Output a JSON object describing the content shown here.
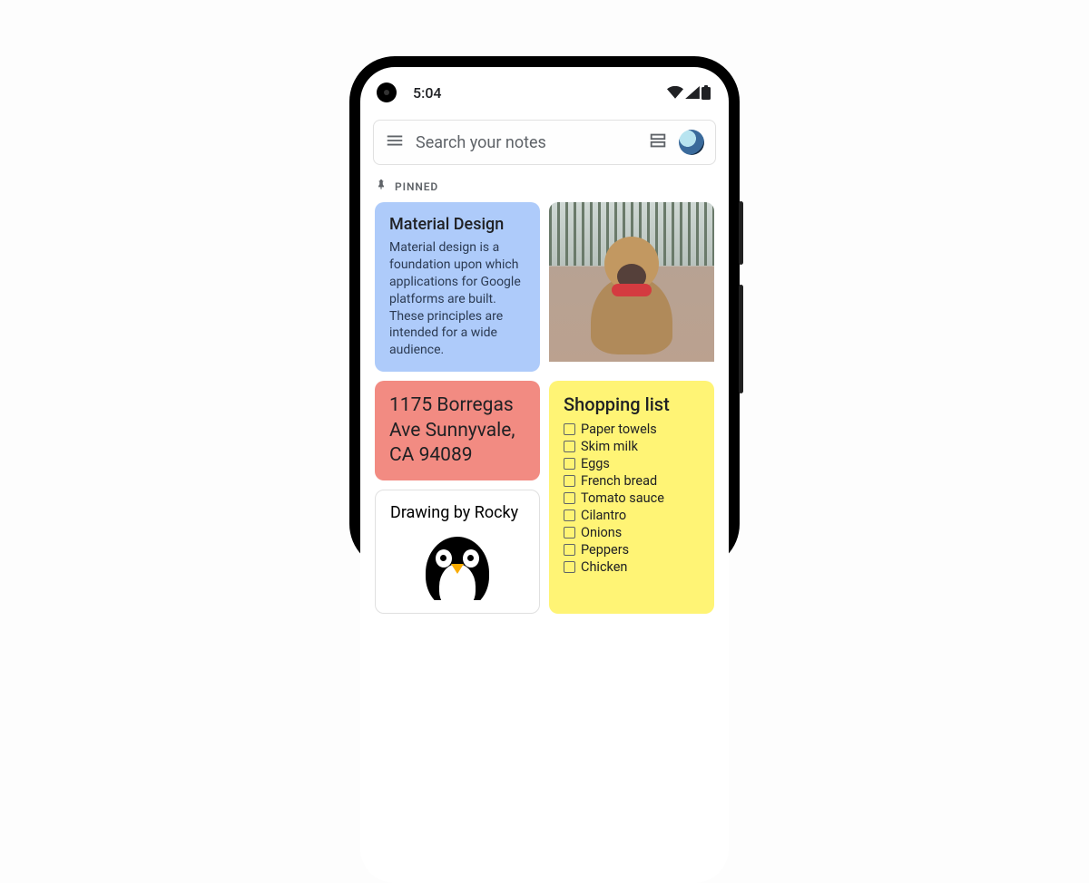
{
  "statusbar": {
    "time": "5:04"
  },
  "search": {
    "placeholder": "Search your notes"
  },
  "section_pinned_label": "PINNED",
  "notes": {
    "material": {
      "title": "Material Design",
      "body": "Material design is a foundation upon which applications for Google platforms are built. These principles are intended for a wide audience."
    },
    "address": {
      "text": "1175 Borregas Ave Sunnyvale, CA 94089"
    },
    "drawing": {
      "title": "Drawing by Rocky"
    },
    "shopping": {
      "title": "Shopping list",
      "items": [
        "Paper towels",
        "Skim milk",
        "Eggs",
        "French bread",
        "Tomato sauce",
        "Cilantro",
        "Onions",
        "Peppers",
        "Chicken"
      ]
    }
  }
}
